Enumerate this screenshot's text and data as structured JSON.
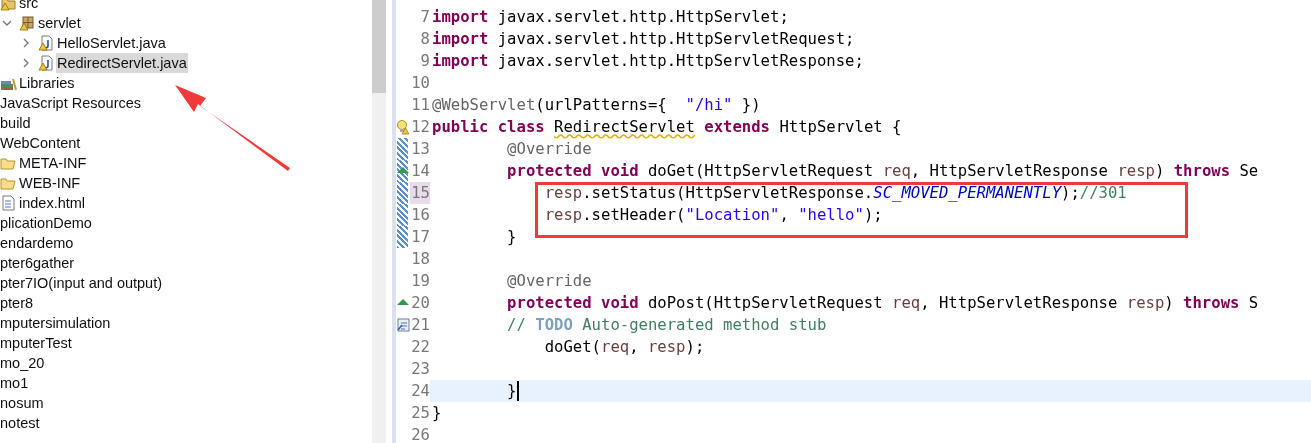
{
  "project_tree": {
    "items": [
      {
        "children": [
          {
            "children": [
              {
                "label": "src",
                "kind": "source",
                "warning": true,
                "selected": false,
                "children": [
                  {
                    "label": "servlet",
                    "kind": "package",
                    "warning": true,
                    "selected": false,
                    "expanded": true,
                    "children": [
                      {
                        "label": "HelloServlet.java",
                        "kind": "java",
                        "warning": true,
                        "selected": false,
                        "expanded": false
                      },
                      {
                        "label": "RedirectServlet.java",
                        "kind": "java",
                        "warning": true,
                        "selected": true,
                        "expanded": false
                      }
                    ]
                  }
                ]
              },
              {
                "label": "Libraries",
                "kind": "library",
                "warning": false,
                "selected": false
              }
            ]
          },
          {
            "label": "JavaScript Resources",
            "selected": false
          },
          {
            "label": "build",
            "selected": false
          },
          {
            "label": "WebContent",
            "selected": false,
            "children": [
              {
                "label": "META-INF",
                "kind": "folder",
                "warning": false,
                "selected": false
              },
              {
                "label": "WEB-INF",
                "kind": "folder",
                "warning": false,
                "selected": false
              },
              {
                "label": "index.html",
                "kind": "html",
                "warning": false,
                "selected": false
              }
            ]
          }
        ]
      },
      {
        "label": "plicationDemo",
        "selected": false
      },
      {
        "label": "endardemo",
        "selected": false
      },
      {
        "label": "pter6gather",
        "selected": false
      },
      {
        "label": "pter7IO(input and output)",
        "selected": false
      },
      {
        "label": "pter8",
        "selected": false
      },
      {
        "label": "mputersimulation",
        "selected": false
      },
      {
        "label": "mputerTest",
        "selected": false
      },
      {
        "label": "mo_20",
        "selected": false
      },
      {
        "label": "mo1",
        "selected": false
      },
      {
        "label": "nosum",
        "selected": false
      },
      {
        "label": "notest",
        "selected": false
      }
    ]
  },
  "editor": {
    "lines": [
      {
        "number": "7",
        "changed": false,
        "marked": false,
        "current": false,
        "tokens": [
          {
            "kind": "keyword",
            "text": "import"
          },
          {
            "kind": "plain",
            "text": " javax.servlet.http.HttpServlet;"
          }
        ]
      },
      {
        "number": "8",
        "changed": false,
        "marked": false,
        "current": false,
        "tokens": [
          {
            "kind": "keyword",
            "text": "import"
          },
          {
            "kind": "plain",
            "text": " javax.servlet.http.HttpServletRequest;"
          }
        ]
      },
      {
        "number": "9",
        "changed": false,
        "marked": false,
        "current": false,
        "tokens": [
          {
            "kind": "keyword",
            "text": "import"
          },
          {
            "kind": "plain",
            "text": " javax.servlet.http.HttpServletResponse;"
          }
        ]
      },
      {
        "number": "10",
        "changed": false,
        "marked": false,
        "current": false
      },
      {
        "number": "11",
        "changed": false,
        "marked": false,
        "current": false,
        "tokens": [
          {
            "kind": "annotation",
            "text": "@WebServlet"
          },
          {
            "kind": "plain",
            "text": "(urlPatterns={  "
          },
          {
            "kind": "string",
            "text": "\"/hi\""
          },
          {
            "kind": "plain",
            "text": " })"
          }
        ]
      },
      {
        "number": "12",
        "gutter": {
          "kind": "warning"
        },
        "changed": false,
        "marked": false,
        "current": false,
        "tokens": [
          {
            "kind": "keyword",
            "text": "public class "
          },
          {
            "kind": "warning",
            "text": "RedirectServlet"
          },
          {
            "kind": "keyword",
            "text": " extends"
          },
          {
            "kind": "plain",
            "text": " HttpServlet {"
          }
        ]
      },
      {
        "number": "13",
        "changed": true,
        "marked": false,
        "current": false,
        "tokens": [
          {
            "kind": "annotation",
            "text": "        @Override"
          }
        ]
      },
      {
        "number": "14",
        "gutter": {
          "kind": "override"
        },
        "changed": true,
        "marked": false,
        "current": false,
        "tokens": [
          {
            "kind": "keyword",
            "text": "        protected void"
          },
          {
            "kind": "plain",
            "text": " doGet(HttpServletRequest "
          },
          {
            "kind": "param",
            "text": "req"
          },
          {
            "kind": "plain",
            "text": ", HttpServletResponse "
          },
          {
            "kind": "param",
            "text": "resp"
          },
          {
            "kind": "plain",
            "text": ") "
          },
          {
            "kind": "keyword",
            "text": "throws"
          },
          {
            "kind": "plain",
            "text": " Se"
          }
        ]
      },
      {
        "number": "15",
        "changed": true,
        "marked": true,
        "current": false,
        "tokens": [
          {
            "kind": "param",
            "text": "            resp"
          },
          {
            "kind": "plain",
            "text": ".setStatus(HttpServletResponse."
          },
          {
            "kind": "field",
            "text": "SC_MOVED_PERMANENTLY"
          },
          {
            "kind": "plain",
            "text": ");"
          },
          {
            "kind": "comment",
            "text": "//301"
          }
        ]
      },
      {
        "number": "16",
        "changed": true,
        "marked": false,
        "current": false,
        "tokens": [
          {
            "kind": "param",
            "text": "            resp"
          },
          {
            "kind": "plain",
            "text": ".setHeader("
          },
          {
            "kind": "string",
            "text": "\"Location\""
          },
          {
            "kind": "plain",
            "text": ", "
          },
          {
            "kind": "string",
            "text": "\"hello\""
          },
          {
            "kind": "plain",
            "text": ");"
          }
        ]
      },
      {
        "number": "17",
        "changed": true,
        "marked": false,
        "current": false,
        "tokens": [
          {
            "kind": "plain",
            "text": "        }"
          }
        ]
      },
      {
        "number": "18",
        "changed": false,
        "marked": false,
        "current": false
      },
      {
        "number": "19",
        "changed": false,
        "marked": false,
        "current": false,
        "tokens": [
          {
            "kind": "annotation",
            "text": "        @Override"
          }
        ]
      },
      {
        "number": "20",
        "gutter": {
          "kind": "override"
        },
        "changed": false,
        "marked": false,
        "current": false,
        "tokens": [
          {
            "kind": "keyword",
            "text": "        protected void"
          },
          {
            "kind": "plain",
            "text": " doPost(HttpServletRequest "
          },
          {
            "kind": "param",
            "text": "req"
          },
          {
            "kind": "plain",
            "text": ", HttpServletResponse "
          },
          {
            "kind": "param",
            "text": "resp"
          },
          {
            "kind": "plain",
            "text": ") "
          },
          {
            "kind": "keyword",
            "text": "throws"
          },
          {
            "kind": "plain",
            "text": " S"
          }
        ]
      },
      {
        "number": "21",
        "gutter": {
          "kind": "task"
        },
        "changed": false,
        "marked": false,
        "current": false,
        "tokens": [
          {
            "kind": "comment",
            "text": "        // "
          },
          {
            "kind": "todo",
            "text": "TODO"
          },
          {
            "kind": "comment",
            "text": " Auto-generated method stub"
          }
        ]
      },
      {
        "number": "22",
        "changed": false,
        "marked": false,
        "current": false,
        "tokens": [
          {
            "kind": "plain",
            "text": "            doGet("
          },
          {
            "kind": "param",
            "text": "req"
          },
          {
            "kind": "plain",
            "text": ", "
          },
          {
            "kind": "param",
            "text": "resp"
          },
          {
            "kind": "plain",
            "text": ");"
          }
        ]
      },
      {
        "number": "23",
        "changed": false,
        "marked": false,
        "current": false
      },
      {
        "number": "24",
        "changed": false,
        "marked": false,
        "current": true,
        "tokens": [
          {
            "kind": "plain",
            "text": "        }"
          }
        ]
      },
      {
        "number": "25",
        "changed": false,
        "marked": false,
        "current": false,
        "tokens": [
          {
            "kind": "plain",
            "text": "}"
          }
        ]
      },
      {
        "number": "26",
        "changed": false,
        "marked": false,
        "current": false
      }
    ]
  }
}
